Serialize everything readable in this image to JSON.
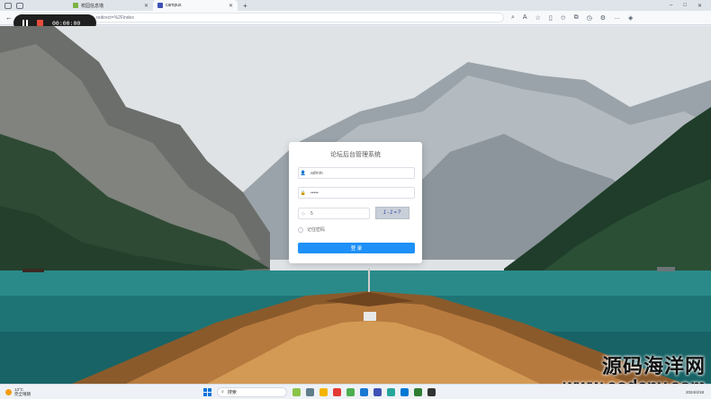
{
  "browser": {
    "tabs": [
      {
        "label": "校园信息墙",
        "active": false
      },
      {
        "label": "campus",
        "active": true
      }
    ],
    "url": "redirect=%2Findex",
    "controls": [
      "–",
      "□",
      "✕"
    ]
  },
  "recorder": {
    "time": "00:00:00"
  },
  "login": {
    "title": "论坛后台管理系统",
    "username": "admin",
    "password": "•••••",
    "code_value": "5",
    "captcha_text": "1-1=?",
    "remember_label": "记住密码",
    "submit_label": "登 录"
  },
  "taskbar": {
    "weather_temp": "13°C",
    "weather_desc": "完全晴朗",
    "search_label": "搜索",
    "date": "2024/4/18"
  },
  "watermark": {
    "line1": "源码海洋网",
    "line2": "www.codeny.com"
  },
  "colors": {
    "accent": "#1e90f7",
    "lake": "#1f6f72"
  }
}
